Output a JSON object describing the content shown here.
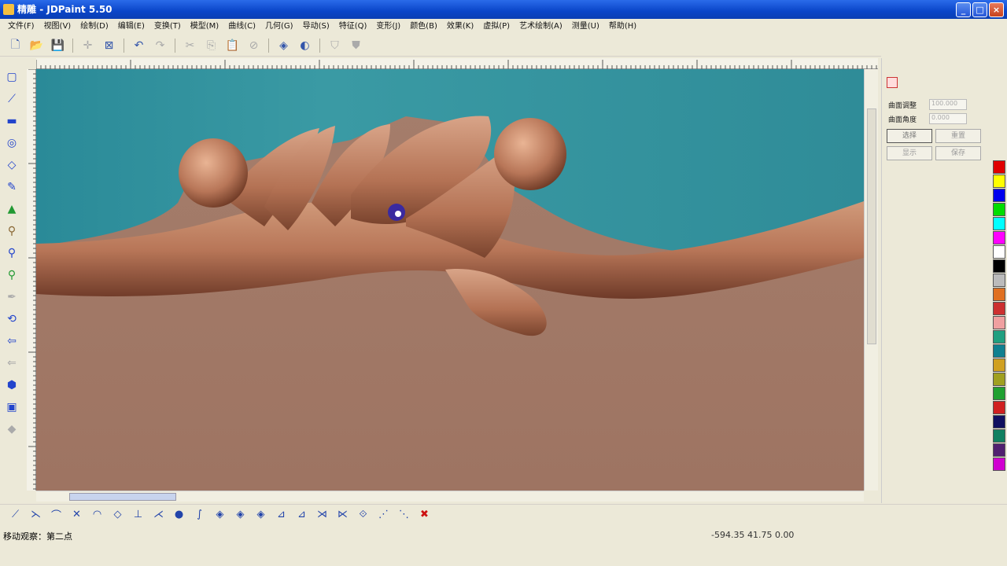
{
  "window": {
    "title": "JDPaint 5.50",
    "prefix": "精雕",
    "colors": {
      "title_bg": "#0a45c8",
      "canvas_top": "#2f8f9a",
      "canvas_bottom": "#a0796a",
      "carving": "#b87658"
    }
  },
  "menu": [
    "文件(F)",
    "视图(V)",
    "绘制(D)",
    "编辑(E)",
    "变换(T)",
    "模型(M)",
    "曲线(C)",
    "几何(G)",
    "导动(S)",
    "特征(Q)",
    "变形(J)",
    "颜色(B)",
    "效果(K)",
    "虚拟(P)",
    "艺术绘制(A)",
    "测量(U)",
    "帮助(H)"
  ],
  "toolbar_icons": [
    "new-file-icon",
    "open-folder-icon",
    "save-icon",
    "move-icon",
    "zoom-box-icon",
    "undo-icon",
    "redo-icon",
    "cut-icon",
    "copy-icon",
    "paste-icon",
    "delete-icon",
    "shade-cube-icon",
    "render-icon",
    "surface-icon",
    "mesh-icon"
  ],
  "left_tools": [
    "select-rect-icon",
    "node-edit-icon",
    "layer-icon",
    "circle-target-icon",
    "tilt-icon",
    "pencil-icon",
    "tree-icon",
    "brush-icon",
    "pin-icon",
    "pin-green-icon",
    "pen-icon",
    "rotate-icon",
    "arrow-left-icon",
    "arrow-left-small-icon",
    "cube-icon",
    "monitor-icon",
    "gem-icon"
  ],
  "right_panel": {
    "labels": [
      "曲面调整",
      "曲面角度"
    ],
    "inputs": [
      "100.000",
      "0.000"
    ],
    "buttons": [
      "选择",
      "重置",
      "显示",
      "保存"
    ]
  },
  "palette": [
    "#e00000",
    "#ffff00",
    "#0000ee",
    "#00dd00",
    "#00ffff",
    "#ff00ff",
    "#ffffff",
    "#000000",
    "#bbbbbb",
    "#e07020",
    "#cc3030",
    "#f0a0a0",
    "#20a080",
    "#108090",
    "#d0a020",
    "#a0a020",
    "#20a030",
    "#d02020",
    "#101060",
    "#108060",
    "#502070",
    "#d000d0"
  ],
  "bottom_tools": [
    "line-icon",
    "polyline-icon",
    "arc-icon",
    "cross-icon",
    "arc2-icon",
    "circle-icon",
    "perpendicular-icon",
    "tangent-icon",
    "point-icon",
    "curve-icon",
    "diamond-icon",
    "diamond2-icon",
    "diamond3-icon",
    "trim-icon",
    "extend-icon",
    "join-icon",
    "break-icon",
    "mirror-icon",
    "offset-icon",
    "fillet-icon",
    "close-red-icon"
  ],
  "status": {
    "prompt": "移动观察：第二点",
    "coords": "-594.35  41.75  0.00"
  }
}
